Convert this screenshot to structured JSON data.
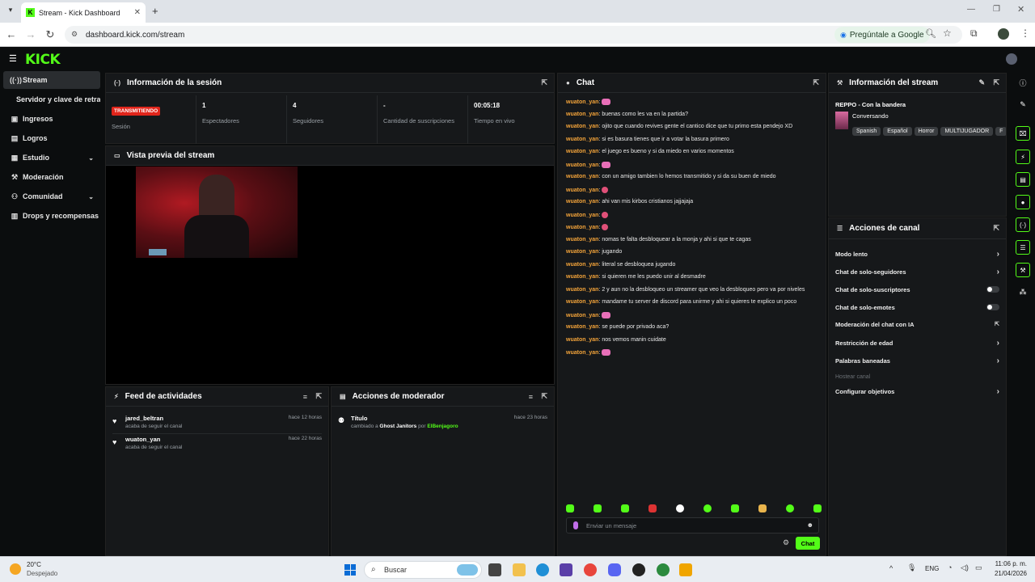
{
  "browser": {
    "tab_title": "Stream - Kick Dashboard",
    "url": "dashboard.kick.com/stream",
    "google_btn": "Pregúntale a Google"
  },
  "app": {
    "logo": "KICK",
    "brand_color": "#53fc18"
  },
  "sidebar": {
    "items": [
      {
        "label": "Stream",
        "icon": "broadcast-icon"
      },
      {
        "label": "Servidor y clave de retransn",
        "icon": ""
      },
      {
        "label": "Ingresos",
        "icon": "money-icon"
      },
      {
        "label": "Logros",
        "icon": "trophy-icon"
      },
      {
        "label": "Estudio",
        "icon": "studio-icon"
      },
      {
        "label": "Moderación",
        "icon": "wrench-icon"
      },
      {
        "label": "Comunidad",
        "icon": "people-icon"
      },
      {
        "label": "Drops y recompensas",
        "icon": "gift-icon"
      }
    ]
  },
  "session": {
    "title": "Información de la sesión",
    "stats": [
      {
        "value": "TRANSMITIENDO",
        "label": "Sesión"
      },
      {
        "value": "1",
        "label": "Espectadores"
      },
      {
        "value": "4",
        "label": "Seguidores"
      },
      {
        "value": "-",
        "label": "Cantidad de suscripciones"
      },
      {
        "value": "00:05:18",
        "label": "Tiempo en vivo"
      }
    ]
  },
  "preview": {
    "title": "Vista previa del stream"
  },
  "feed": {
    "title": "Feed de actividades",
    "items": [
      {
        "name": "jared_beltran",
        "desc": "acaba de seguir el canal",
        "time": "hace 12 horas"
      },
      {
        "name": "wuaton_yan",
        "desc": "acaba de seguir el canal",
        "time": "hace 22 horas"
      }
    ]
  },
  "modactions": {
    "title": "Acciones de moderador",
    "item": {
      "title": "Título",
      "prefix": "cambiado a",
      "value": "Ghost Janitors",
      "by": "por",
      "user": "ElBenjagoro",
      "time": "hace 23 horas"
    }
  },
  "chat": {
    "title": "Chat",
    "placeholder": "Enviar un mensaje",
    "send_label": "Chat",
    "messages": [
      {
        "user": "wuaton_yan",
        "text": "",
        "emote": "kirby"
      },
      {
        "user": "wuaton_yan",
        "text": "buenas como les va en la partida?"
      },
      {
        "user": "wuaton_yan",
        "text": "ojito que cuando revives gente el cantico dice que tu primo esta pendejo XD"
      },
      {
        "user": "wuaton_yan",
        "text": "si es basura tienes que ir a votar la basura primero"
      },
      {
        "user": "wuaton_yan",
        "text": "el juego es bueno y si da miedo en varios momentos"
      },
      {
        "user": "wuaton_yan",
        "text": "",
        "emote": "kirby"
      },
      {
        "user": "wuaton_yan",
        "text": "con un amigo tambien lo hemos transmitido y si da su buen de miedo"
      },
      {
        "user": "wuaton_yan",
        "text": "",
        "emote": "heart"
      },
      {
        "user": "wuaton_yan",
        "text": "ahi van mis kirbos cristianos jajjajaja"
      },
      {
        "user": "wuaton_yan",
        "text": "",
        "emote": "heart"
      },
      {
        "user": "wuaton_yan",
        "text": "",
        "emote": "heart"
      },
      {
        "user": "wuaton_yan",
        "text": "nomas te falta desbloquear a la monja y ahi si que te cagas"
      },
      {
        "user": "wuaton_yan",
        "text": "jugando"
      },
      {
        "user": "wuaton_yan",
        "text": "literal se desbloquea jugando"
      },
      {
        "user": "wuaton_yan",
        "text": "si quieren me les puedo unir al desmadre"
      },
      {
        "user": "wuaton_yan",
        "text": "2 y aun no la desbloqueo un streamer que veo la desbloqueo pero va por niveles"
      },
      {
        "user": "wuaton_yan",
        "text": "mandame tu server de discord para unirme y ahi si quieres te explico un poco"
      },
      {
        "user": "wuaton_yan",
        "text": "",
        "emote": "kirby"
      },
      {
        "user": "wuaton_yan",
        "text": "se puede por privado aca?"
      },
      {
        "user": "wuaton_yan",
        "text": "nos vemos manin cuidate"
      },
      {
        "user": "wuaton_yan",
        "text": "",
        "emote": "kirby"
      }
    ]
  },
  "streaminfo": {
    "title": "Información del stream",
    "stream_title": "REPPO - Con la bandera",
    "category": "Conversando",
    "tags": [
      "Spanish",
      "Español",
      "Horror",
      "MULTIJUGADOR",
      "F"
    ]
  },
  "channel": {
    "title": "Acciones de canal",
    "actions": [
      {
        "label": "Modo lento",
        "control": "arrow"
      },
      {
        "label": "Chat de solo-seguidores",
        "control": "arrow"
      },
      {
        "label": "Chat de solo-suscriptores",
        "control": "toggle"
      },
      {
        "label": "Chat de solo-emotes",
        "control": "toggle"
      },
      {
        "label": "Moderación del chat con IA",
        "control": "external"
      },
      {
        "label": "Restricción de edad",
        "control": "arrow"
      },
      {
        "label": "Palabras baneadas",
        "control": "arrow"
      },
      {
        "label": "Hostear canal",
        "control": "disabled"
      },
      {
        "label": "Configurar objetivos",
        "control": "arrow"
      }
    ]
  },
  "taskbar": {
    "temp": "20°C",
    "weather": "Despejado",
    "search": "Buscar",
    "lang": "ENG",
    "time": "11:06 p. m.",
    "date": "21/04/2026"
  }
}
